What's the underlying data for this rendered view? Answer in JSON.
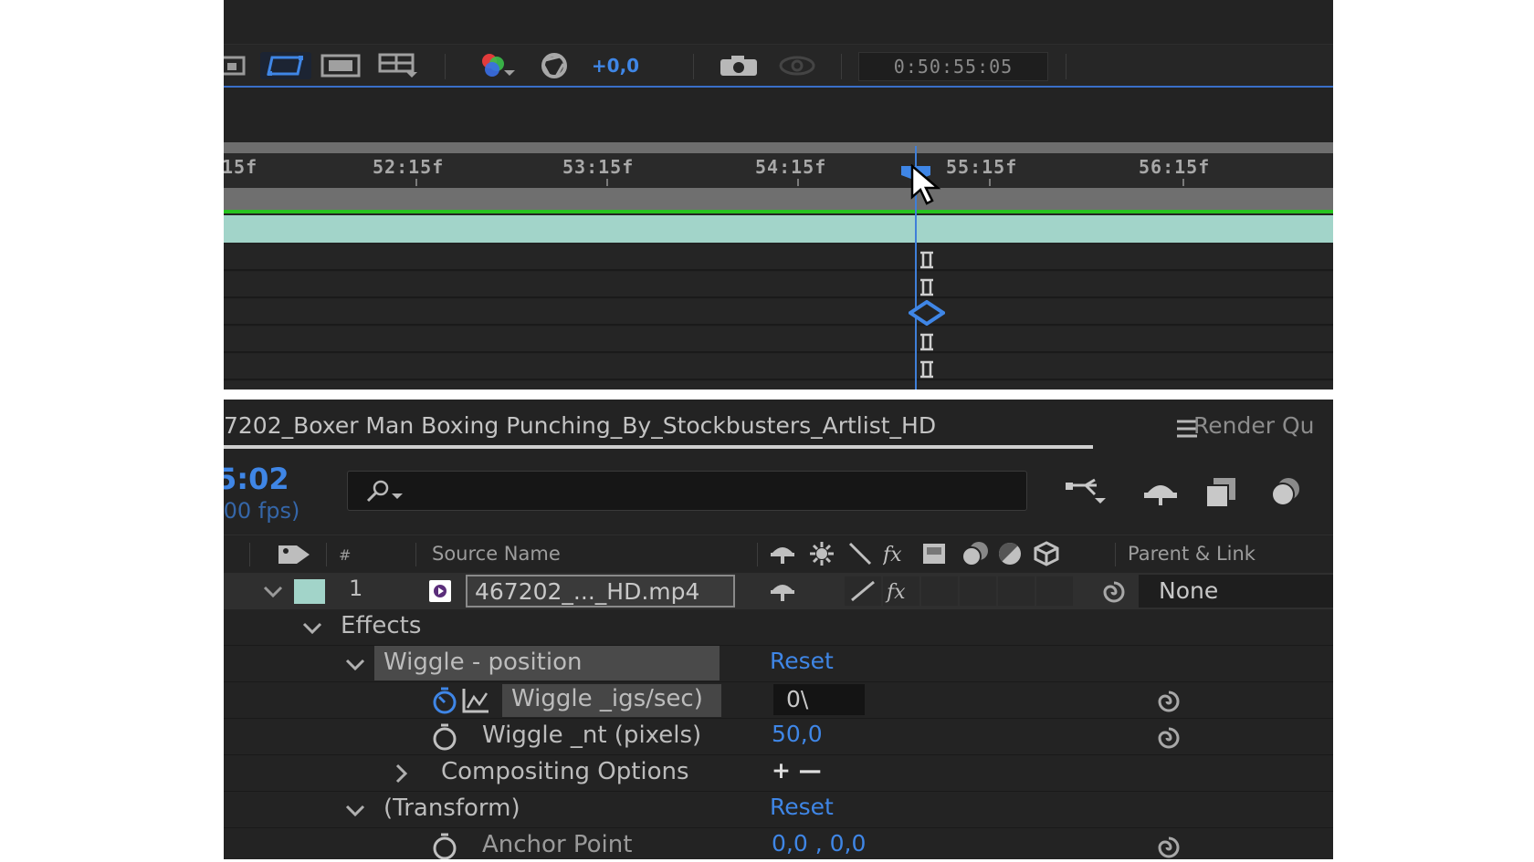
{
  "viewer_toolbar": {
    "exposure_value": "+0,0",
    "timecode": "0:50:55:05"
  },
  "timeline_ruler": {
    "ticks": [
      "15f",
      "52:15f",
      "53:15f",
      "54:15f",
      "55:15f",
      "56:15f"
    ]
  },
  "composition": {
    "tab_title": "7202_Boxer Man Boxing Punching_By_Stockbusters_Artlist_HD",
    "render_queue_tab": "Render Qu",
    "current_time": "5:02",
    "fps": ".00 fps)"
  },
  "columns": {
    "source_name": "Source Name",
    "parent_link": "Parent & Link"
  },
  "layer": {
    "number": "1",
    "name": "467202_..._HD.mp4",
    "parent": "None",
    "label_color": "#a2d4c9"
  },
  "properties": {
    "effects_label": "Effects",
    "wiggle_position_label": "Wiggle - position",
    "wiggle_position_value": "Reset",
    "wiggle_freq_label": "Wiggle _igs/sec)",
    "wiggle_freq_value": "0\\",
    "wiggle_amount_label": "Wiggle _nt (pixels)",
    "wiggle_amount_value": "50,0",
    "compositing_label": "Compositing Options",
    "compositing_value": "+ —",
    "transform_label": "(Transform)",
    "transform_value": "Reset",
    "anchor_label": "Anchor Point",
    "anchor_value": "0,0 , 0,0"
  },
  "colors": {
    "accent_blue": "#3f86e6",
    "layer_teal": "#a2d4c9",
    "work_area_green": "#27c21f"
  }
}
